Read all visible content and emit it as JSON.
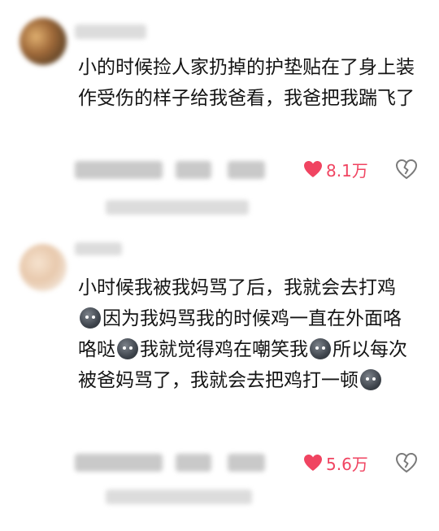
{
  "comments": [
    {
      "text": "小的时候捡人家扔掉的护垫贴在了身上装作受伤的样子给我爸看，我爸把我踹飞了",
      "likes": "8.1万"
    },
    {
      "text_parts": [
        "小时候我被我妈骂了后，我就会去打鸡",
        "因为我妈骂我的时候鸡一直在外面咯咯哒",
        "我就觉得鸡在嘲笑我",
        "所以每次被爸妈骂了，我就会去把鸡打一顿"
      ],
      "likes": "5.6万"
    }
  ],
  "colors": {
    "like": "#f04461",
    "text": "#141414"
  },
  "icons": {
    "like": "heart-icon",
    "dislike": "broken-heart-icon",
    "emoji": "dark-round-face-emoji"
  }
}
